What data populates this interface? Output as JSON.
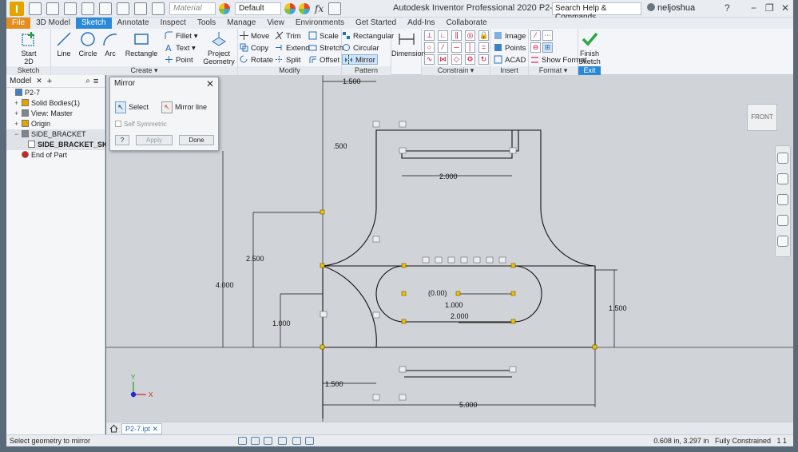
{
  "titlebar": {
    "material_placeholder": "Material",
    "appearance": "Default",
    "fx": "fx",
    "app_title": "Autodesk Inventor Professional 2020   P2-7",
    "help_search": "Search Help & Commands...",
    "user": "neljoshua",
    "help_glyph": "?",
    "minimize_glyph": "−",
    "restore_glyph": "❐",
    "close_glyph": "✕"
  },
  "tabs": [
    "File",
    "3D Model",
    "Sketch",
    "Annotate",
    "Inspect",
    "Tools",
    "Manage",
    "View",
    "Environments",
    "Get Started",
    "Add-Ins",
    "Collaborate"
  ],
  "active_tab": "Sketch",
  "ribbon": {
    "sketch_group": {
      "title": "Sketch",
      "start_line1": "Start",
      "start_line2": "2D Sketch"
    },
    "create_group": {
      "title": "Create ▾",
      "line": "Line",
      "circle": "Circle",
      "arc": "Arc",
      "rectangle": "Rectangle",
      "fillet": "Fillet ▾",
      "text": "Text ▾",
      "point": "Point",
      "project_line1": "Project",
      "project_line2": "Geometry"
    },
    "modify_group": {
      "title": "Modify",
      "move": "Move",
      "trim": "Trim",
      "scale": "Scale",
      "copy": "Copy",
      "extend": "Extend",
      "stretch": "Stretch",
      "rotate": "Rotate",
      "split": "Split",
      "offset": "Offset"
    },
    "pattern_group": {
      "title": "Pattern",
      "rectangular": "Rectangular",
      "circular": "Circular",
      "mirror": "Mirror"
    },
    "dimension": "Dimension",
    "constrain_group": {
      "title": "Constrain ▾"
    },
    "insert_group": {
      "title": "Insert",
      "image": "Image",
      "points": "Points",
      "acad": "ACAD"
    },
    "format_group": {
      "title": "Format ▾",
      "show_format": "Show Format"
    },
    "exit_group": {
      "title": "Exit",
      "finish_line1": "Finish",
      "finish_line2": "Sketch"
    }
  },
  "browser": {
    "tab": "Model",
    "items": [
      {
        "label": "P2-7",
        "level": 0,
        "toggle": ""
      },
      {
        "label": "Solid Bodies(1)",
        "level": 1,
        "toggle": "+"
      },
      {
        "label": "View: Master",
        "level": 1,
        "toggle": "+"
      },
      {
        "label": "Origin",
        "level": 1,
        "toggle": "+"
      },
      {
        "label": "SIDE_BRACKET",
        "level": 1,
        "toggle": "−"
      },
      {
        "label": "SIDE_BRACKET_SKETCH",
        "level": 2,
        "toggle": ""
      },
      {
        "label": "End of Part",
        "level": 1,
        "toggle": ""
      }
    ]
  },
  "mirror_dialog": {
    "title": "Mirror",
    "select": "Select",
    "mirror_line": "Mirror line",
    "self_symmetric": "Self Symmetric",
    "help": "?",
    "apply": "Apply",
    "done": "Done"
  },
  "viewcube": "FRONT",
  "dimensions": {
    "d_1500_top": "1.500",
    "d_500": ".500",
    "d_2000_top": "2.000",
    "d_2500": "2.500",
    "d_4000": "4.000",
    "d_1000_left": "1.000",
    "d_000": "(0.00)",
    "d_1000_mid": "1.000",
    "d_2000_slot": "2.000",
    "d_1500_right": "1.500",
    "d_1500_bottom": "1.500",
    "d_5000": "5.000"
  },
  "triad": {
    "x": "X",
    "y": "Y"
  },
  "doc_tab": "P2-7.ipt ✕",
  "status": {
    "message": "Select geometry to mirror",
    "coords": "0.608 in, 3.297 in",
    "constraint": "Fully Constrained",
    "counts": "1  1"
  },
  "colors": {
    "accent": "#2a88d8",
    "file_tab": "#e48f1b",
    "finish_check": "#28a745",
    "sketch_line": "#111111",
    "constraint_point": "#f2c200"
  }
}
